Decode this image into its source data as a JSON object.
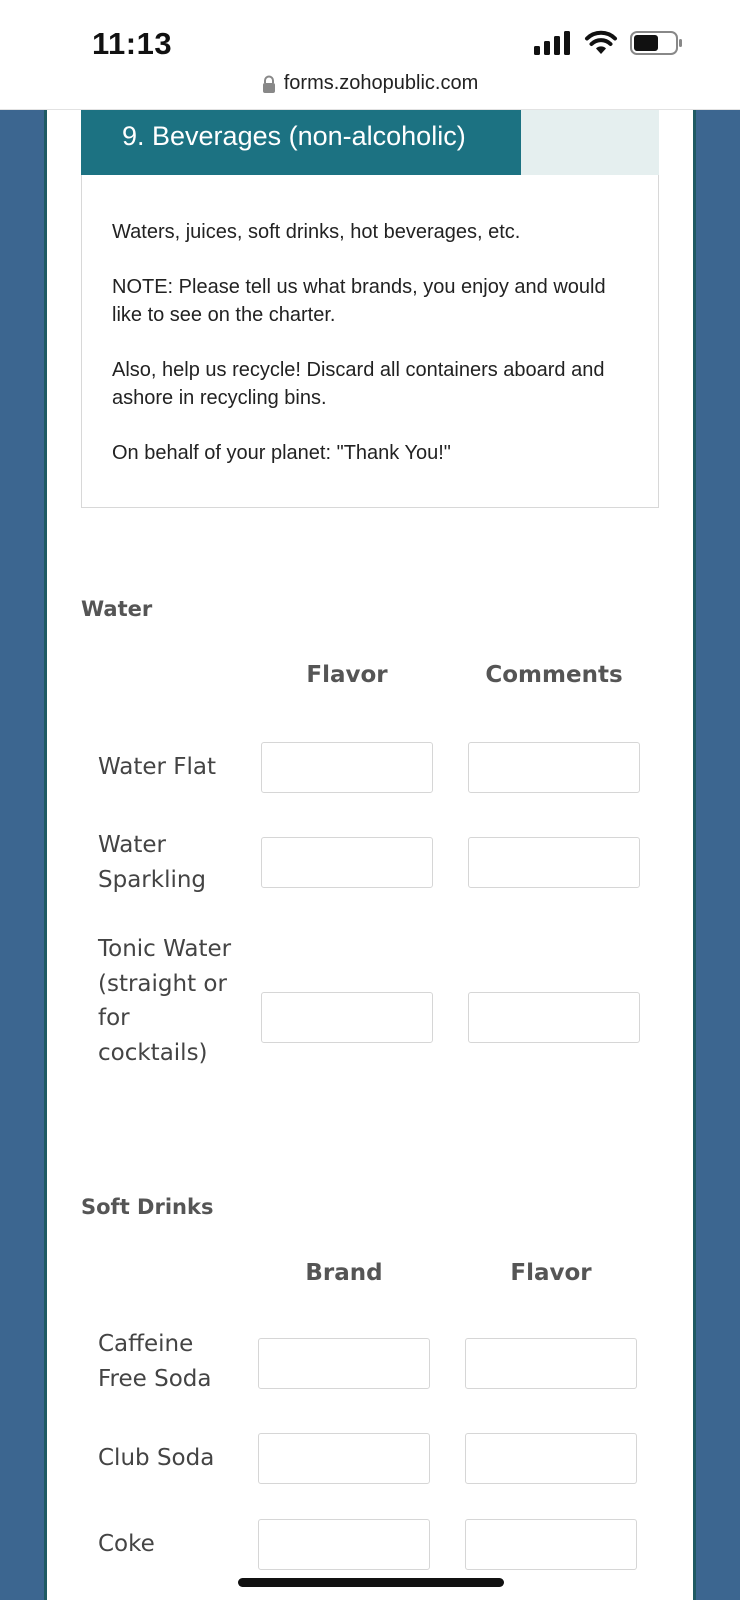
{
  "status_bar": {
    "time": "11:13"
  },
  "browser": {
    "url": "forms.zohopublic.com"
  },
  "section": {
    "title": "9. Beverages (non-alcoholic)",
    "description": [
      "Waters, juices, soft drinks, hot beverages, etc.",
      "NOTE:  Please tell us what brands, you enjoy and would like to see on the charter.",
      "Also, help us recycle! Discard all containers aboard and ashore in recycling bins.",
      "On behalf of your planet: \"Thank You!\""
    ]
  },
  "water": {
    "label": "Water",
    "columns": [
      "Flavor",
      "Comments"
    ],
    "rows": [
      {
        "label": "Water Flat",
        "values": [
          "",
          ""
        ]
      },
      {
        "label": "Water Sparkling",
        "values": [
          "",
          ""
        ]
      },
      {
        "label": "Tonic Water (straight or for cocktails)",
        "values": [
          "",
          ""
        ]
      }
    ]
  },
  "soft_drinks": {
    "label": "Soft Drinks",
    "columns": [
      "Brand",
      "Flavor"
    ],
    "rows": [
      {
        "label": "Caffeine Free Soda",
        "values": [
          "",
          ""
        ]
      },
      {
        "label": "Club Soda",
        "values": [
          "",
          ""
        ]
      },
      {
        "label": "Coke",
        "values": [
          "",
          ""
        ]
      }
    ]
  }
}
